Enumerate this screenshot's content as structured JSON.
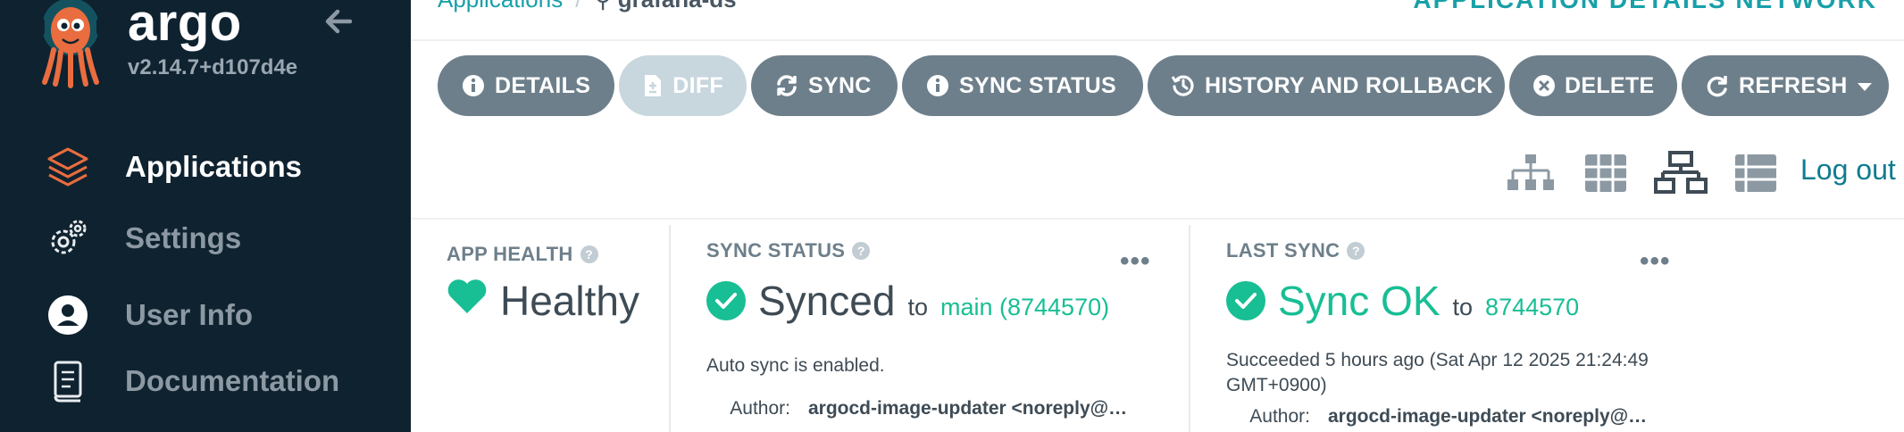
{
  "sidebar": {
    "logo_text": "argo",
    "version": "v2.14.7+d107d4e",
    "items": [
      {
        "label": "Applications",
        "icon": "layers-icon",
        "active": true
      },
      {
        "label": "Settings",
        "icon": "gears-icon",
        "active": false
      },
      {
        "label": "User Info",
        "icon": "user-circle-icon",
        "active": false
      },
      {
        "label": "Documentation",
        "icon": "book-icon",
        "active": false
      }
    ]
  },
  "header": {
    "breadcrumb_root": "Applications",
    "breadcrumb_current": "grafana-ds",
    "page_title": "APPLICATION DETAILS NETWORK"
  },
  "toolbar": {
    "details": "DETAILS",
    "diff": "DIFF",
    "sync": "SYNC",
    "sync_status": "SYNC STATUS",
    "history": "HISTORY AND ROLLBACK",
    "delete": "DELETE",
    "refresh": "REFRESH"
  },
  "views": {
    "logout": "Log out"
  },
  "app_health": {
    "label": "APP HEALTH",
    "value": "Healthy"
  },
  "sync_status": {
    "label": "SYNC STATUS",
    "value": "Synced",
    "to": "to",
    "revision": "main (8744570)",
    "auto_sync": "Auto sync is enabled.",
    "author_key": "Author:",
    "author_value": "argocd-image-updater <noreply@…"
  },
  "last_sync": {
    "label": "LAST SYNC",
    "value": "Sync OK",
    "to": "to",
    "revision": "8744570",
    "succeeded": "Succeeded 5 hours ago (Sat Apr 12 2025 21:24:49 GMT+0900)",
    "author_key": "Author:",
    "author_value": "argocd-image-updater <noreply@…"
  },
  "colors": {
    "sidebar_bg": "#0f2230",
    "button_bg": "#6d7f8b",
    "accent_green": "#18be94",
    "accent_teal": "#19a0a8",
    "logo_orange": "#e96d3f"
  }
}
